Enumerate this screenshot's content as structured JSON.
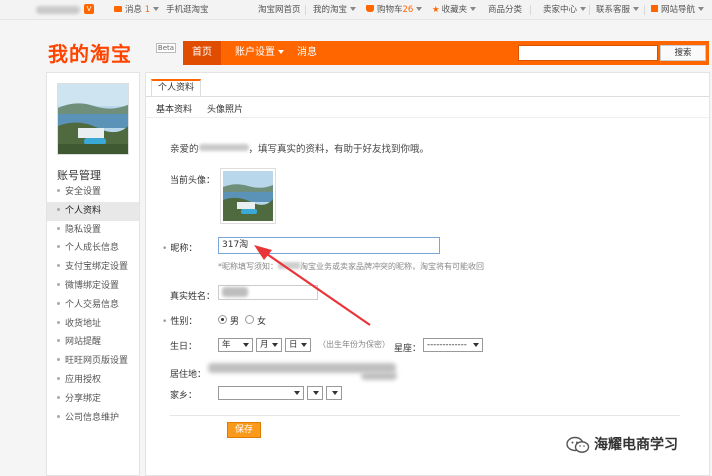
{
  "topbar": {
    "badge": "V",
    "messages_label": "消息",
    "messages_count": "1",
    "mobile_label": "手机逛淘宝",
    "taobao_home": "淘宝网首页",
    "my_taobao": "我的淘宝",
    "cart_label": "购物车",
    "cart_count": "26",
    "favorites": "收藏夹",
    "categories": "商品分类",
    "seller_center": "卖家中心",
    "contact_service": "联系客服",
    "site_nav": "网站导航"
  },
  "header": {
    "logo": "我的淘宝",
    "beta": "Beta",
    "nav": {
      "home": "首页",
      "account_settings": "账户设置",
      "messages": "消息"
    },
    "search_button": "搜索",
    "search_value": ""
  },
  "sidebar": {
    "title": "账号管理",
    "items": [
      {
        "label": "安全设置"
      },
      {
        "label": "个人资料",
        "active": true
      },
      {
        "label": "隐私设置"
      },
      {
        "label": "个人成长信息"
      },
      {
        "label": "支付宝绑定设置"
      },
      {
        "label": "微博绑定设置"
      },
      {
        "label": "个人交易信息"
      },
      {
        "label": "收货地址"
      },
      {
        "label": "网站提醒"
      },
      {
        "label": "旺旺网页版设置"
      },
      {
        "label": "应用授权"
      },
      {
        "label": "分享绑定"
      },
      {
        "label": "公司信息维护"
      }
    ]
  },
  "main": {
    "tab": "个人资料",
    "subtabs": [
      "基本资料",
      "头像照片"
    ],
    "greeting_prefix": "亲爱的",
    "greeting_suffix": "，填写真实的资料，有助于好友找到你哦。",
    "form": {
      "current_avatar_label": "当前头像：",
      "nickname_label": "昵称：",
      "nickname_value": "317淘",
      "nickname_hint_prefix": "*昵称填写须知：",
      "nickname_hint_suffix": "淘宝业务或卖家品牌冲突的昵称，淘宝将有可能收回",
      "realname_label": "真实姓名：",
      "gender_label": "性别：",
      "gender_options": [
        "男",
        "女"
      ],
      "gender_selected": "男",
      "birthday_label": "生日：",
      "year": "年",
      "month": "月",
      "day": "日",
      "birthday_note": "（出生年份为保密）",
      "zodiac_label": "星座：",
      "zodiac_value": "-------------",
      "residence_label": "居住地：",
      "hometown_label": "家乡：",
      "save_button": "保存"
    }
  },
  "watermark": {
    "text": "海耀电商学习"
  },
  "colors": {
    "accent": "#ff6600",
    "arrow": "#e8353a",
    "save": "#f99a1c"
  }
}
